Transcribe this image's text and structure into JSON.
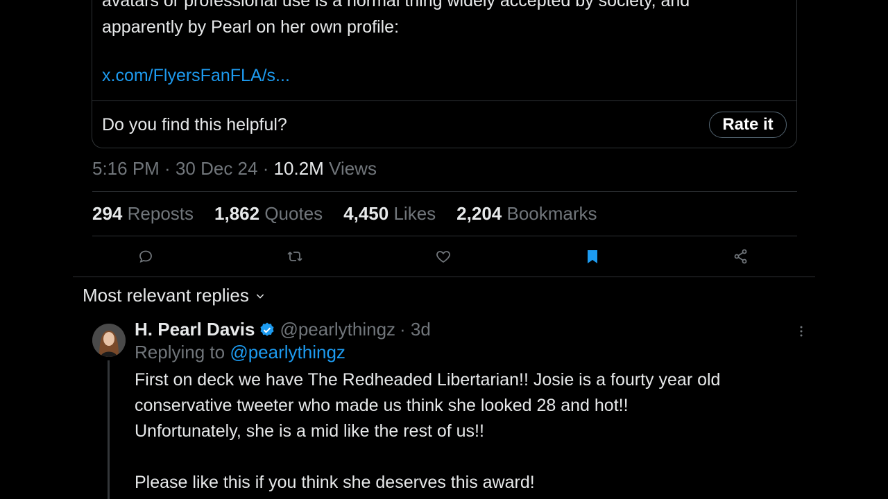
{
  "note": {
    "text_lines": [
      "avatars or professional use is a normal thing widely accepted by society, and",
      "apparently by Pearl on her own profile:"
    ],
    "link": "x.com/FlyersFanFLA/s...",
    "helpful_question": "Do you find this helpful?",
    "rate_label": "Rate it"
  },
  "post_meta": {
    "time": "5:16 PM",
    "date": "30 Dec 24",
    "views_count": "10.2M",
    "views_label": "Views",
    "separator": " · "
  },
  "stats": [
    {
      "count": "294",
      "label": "Reposts"
    },
    {
      "count": "1,862",
      "label": "Quotes"
    },
    {
      "count": "4,450",
      "label": "Likes"
    },
    {
      "count": "2,204",
      "label": "Bookmarks"
    }
  ],
  "actions": {
    "reply_icon": "reply-icon",
    "repost_icon": "repost-icon",
    "like_icon": "heart-icon",
    "bookmark_icon": "bookmark-icon",
    "share_icon": "share-icon",
    "bookmark_active_color": "#1d9bf0"
  },
  "replies_sort": {
    "label": "Most relevant replies"
  },
  "reply": {
    "name": "H. Pearl Davis",
    "verified": true,
    "handle": "@pearlythingz",
    "age": "· 3d",
    "replying_prefix": "Replying to",
    "replying_to": "@pearlythingz",
    "body_lines": [
      "First on deck we have The Redheaded Libertarian!! Josie is a fourty year old",
      "conservative tweeter who made us think she looked 28 and hot!!",
      "Unfortunately, she is a mid like the rest of us!!",
      "",
      "Please like this if you think she deserves this award!"
    ]
  }
}
